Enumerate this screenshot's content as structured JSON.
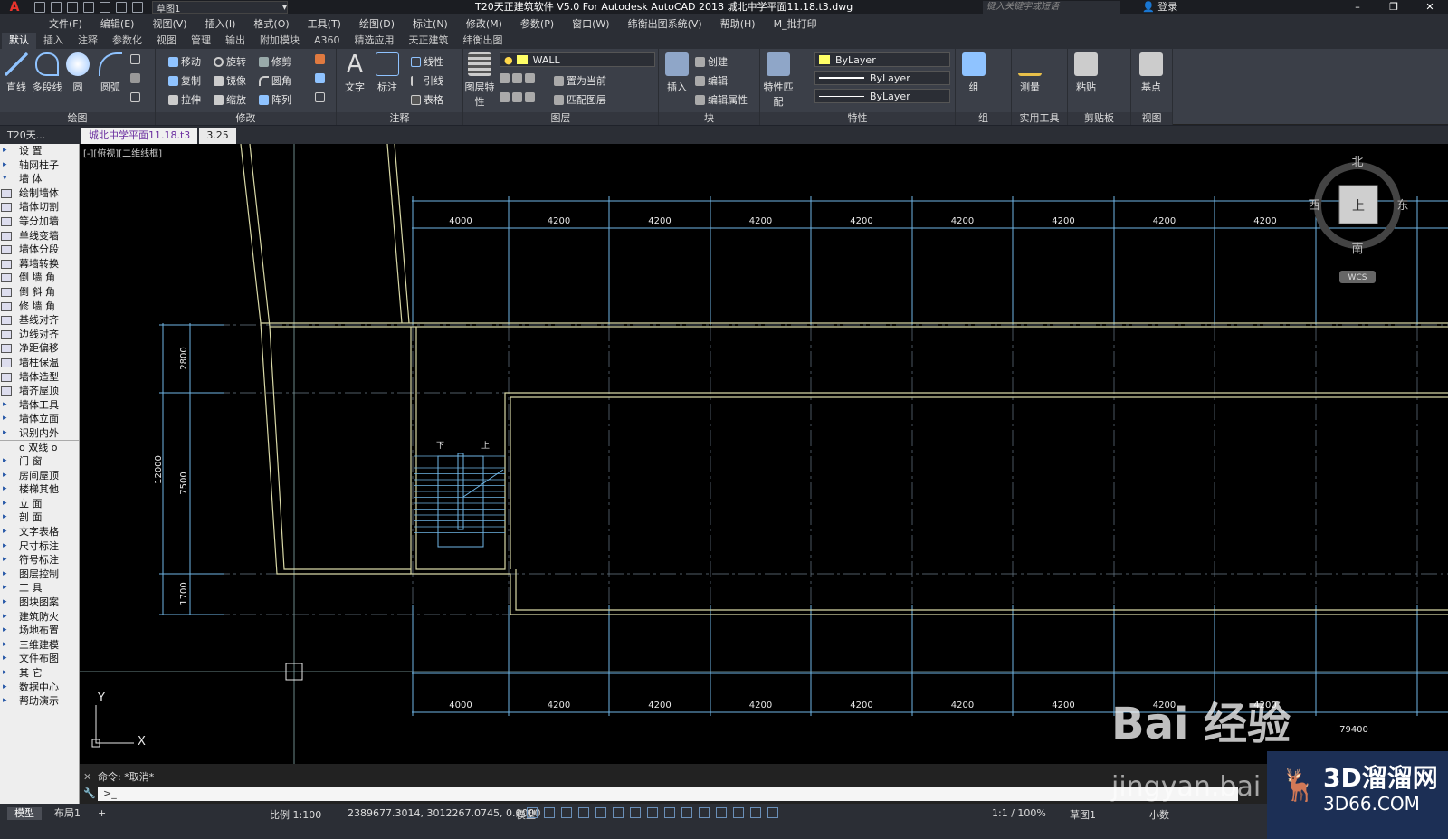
{
  "titlebar": {
    "workspace": "草图1",
    "title": "T20天正建筑软件 V5.0 For Autodesk AutoCAD 2018    城北中学平面11.18.t3.dwg",
    "search_placeholder": "键入关键字或短语",
    "login": "登录"
  },
  "menu": [
    "文件(F)",
    "编辑(E)",
    "视图(V)",
    "插入(I)",
    "格式(O)",
    "工具(T)",
    "绘图(D)",
    "标注(N)",
    "修改(M)",
    "参数(P)",
    "窗口(W)",
    "纬衡出图系统(V)",
    "帮助(H)",
    "M_批打印"
  ],
  "ribbon_tabs": [
    "默认",
    "插入",
    "注释",
    "参数化",
    "视图",
    "管理",
    "输出",
    "附加模块",
    "A360",
    "精选应用",
    "天正建筑",
    "纬衡出图"
  ],
  "ribbon": {
    "draw": {
      "title": "绘图",
      "line": "直线",
      "polyline": "多段线",
      "circle": "圆",
      "arc": "圆弧"
    },
    "modify": {
      "title": "修改",
      "move": "移动",
      "rotate": "旋转",
      "trim": "修剪",
      "copy": "复制",
      "mirror": "镜像",
      "fillet": "圆角",
      "stretch": "拉伸",
      "scale": "缩放",
      "array": "阵列"
    },
    "annotation": {
      "title": "注释",
      "text": "文字",
      "dim": "标注",
      "linear": "线性",
      "leader": "引线",
      "table": "表格"
    },
    "layers": {
      "title": "图层",
      "props": "图层特性",
      "current_layer": "WALL",
      "set_current": "置为当前",
      "match": "匹配图层"
    },
    "block": {
      "title": "块",
      "insert": "插入",
      "create": "创建",
      "edit": "编辑",
      "edit_attr": "编辑属性"
    },
    "properties": {
      "title": "特性",
      "match": "特性匹配",
      "color": "ByLayer",
      "linetype": "ByLayer",
      "lineweight": "ByLayer"
    },
    "groups": {
      "title": "组",
      "group": "组"
    },
    "utilities": {
      "title": "实用工具",
      "measure": "测量"
    },
    "clipboard": {
      "title": "剪贴板",
      "paste": "粘贴"
    },
    "view": {
      "title": "视图",
      "base": "基点"
    }
  },
  "doc_tabs": {
    "left": "T20天...",
    "active": "城北中学平面11.18.t3",
    "second": "3.25"
  },
  "sidebar": [
    {
      "label": "设    置",
      "kind": "arrow"
    },
    {
      "label": "轴网柱子",
      "kind": "arrow"
    },
    {
      "label": "墙    体",
      "kind": "open"
    },
    {
      "label": "绘制墙体",
      "kind": "icon"
    },
    {
      "label": "墙体切割",
      "kind": "icon"
    },
    {
      "label": "等分加墙",
      "kind": "icon"
    },
    {
      "label": "单线变墙",
      "kind": "icon"
    },
    {
      "label": "墙体分段",
      "kind": "icon"
    },
    {
      "label": "幕墙转换",
      "kind": "icon"
    },
    {
      "label": "倒 墙 角",
      "kind": "icon"
    },
    {
      "label": "倒 斜 角",
      "kind": "icon"
    },
    {
      "label": "修 墙 角",
      "kind": "icon"
    },
    {
      "label": "基线对齐",
      "kind": "icon"
    },
    {
      "label": "边线对齐",
      "kind": "icon"
    },
    {
      "label": "净距偏移",
      "kind": "icon"
    },
    {
      "label": "墙柱保温",
      "kind": "icon"
    },
    {
      "label": "墙体造型",
      "kind": "icon"
    },
    {
      "label": "墙齐屋顶",
      "kind": "icon"
    },
    {
      "label": "墙体工具",
      "kind": "arrow"
    },
    {
      "label": "墙体立面",
      "kind": "arrow"
    },
    {
      "label": "识别内外",
      "kind": "arrow"
    },
    {
      "label": "o 双线 o",
      "kind": "sep"
    },
    {
      "label": "门    窗",
      "kind": "arrow"
    },
    {
      "label": "房间屋顶",
      "kind": "arrow"
    },
    {
      "label": "楼梯其他",
      "kind": "arrow"
    },
    {
      "label": "立    面",
      "kind": "arrow"
    },
    {
      "label": "剖    面",
      "kind": "arrow"
    },
    {
      "label": "文字表格",
      "kind": "arrow"
    },
    {
      "label": "尺寸标注",
      "kind": "arrow"
    },
    {
      "label": "符号标注",
      "kind": "arrow"
    },
    {
      "label": "图层控制",
      "kind": "arrow"
    },
    {
      "label": "工    具",
      "kind": "arrow"
    },
    {
      "label": "图块图案",
      "kind": "arrow"
    },
    {
      "label": "建筑防火",
      "kind": "arrow"
    },
    {
      "label": "场地布置",
      "kind": "arrow"
    },
    {
      "label": "三维建模",
      "kind": "arrow"
    },
    {
      "label": "文件布图",
      "kind": "arrow"
    },
    {
      "label": "其    它",
      "kind": "arrow"
    },
    {
      "label": "数据中心",
      "kind": "arrow"
    },
    {
      "label": "帮助演示",
      "kind": "arrow"
    }
  ],
  "viewport": {
    "label": "[-][俯视][二维线框]",
    "top_dims": [
      "4000",
      "4200",
      "4200",
      "4200",
      "4200",
      "4200",
      "4200",
      "4200",
      "4200"
    ],
    "bottom_dims": [
      "4000",
      "4200",
      "4200",
      "4200",
      "4200",
      "4200",
      "4200",
      "4200",
      "4200"
    ],
    "total_dim": "79400",
    "left_dims": [
      "2800",
      "7500",
      "1700"
    ],
    "left_total": "12000",
    "compass": {
      "n": "北",
      "s": "南",
      "e": "东",
      "w": "西",
      "center": "上",
      "wcs": "WCS"
    },
    "ucs": {
      "x": "X",
      "y": "Y"
    }
  },
  "command": {
    "history": "命令: *取消*",
    "prompt": ">_"
  },
  "status": {
    "model_tab": "模型",
    "layout_tab": "布局1",
    "add": "+",
    "scale": "比例 1:100",
    "coords": "2389677.3014, 3012267.0745, 0.0000",
    "space": "模型",
    "annot_scale": "1:1 / 100%",
    "workspace": "草图1",
    "units": "小数"
  },
  "watermarks": {
    "baidu": "Bai 经验",
    "baidu_sub": "jingyan.bai",
    "brand": "3D溜溜网",
    "brand_sub": "3D66.COM"
  }
}
